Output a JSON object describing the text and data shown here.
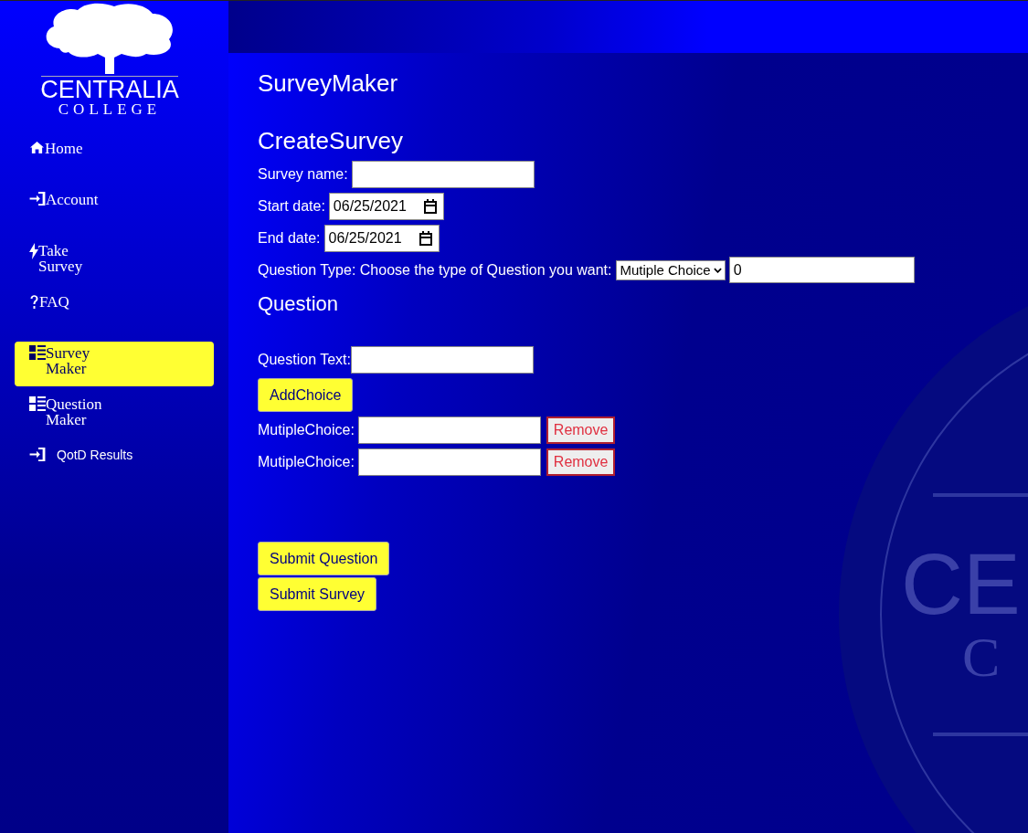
{
  "logo": {
    "name": "CENTRALIA",
    "subname": "COLLEGE"
  },
  "sidebar": {
    "items": [
      {
        "label": "Home",
        "selected": false
      },
      {
        "label": "Account",
        "selected": false
      },
      {
        "label": "Take Survey",
        "selected": false
      },
      {
        "label": "FAQ",
        "selected": false
      },
      {
        "label": "Survey Maker",
        "selected": true
      },
      {
        "label": "Question Maker",
        "selected": false
      },
      {
        "label": "QotD Results",
        "selected": false
      }
    ]
  },
  "page_title": "SurveyMaker",
  "section_title": "CreateSurvey",
  "form": {
    "survey_name_label": "Survey name:",
    "start_date_label": "Start date:",
    "start_date": "06/25/2021",
    "end_date_label": "End date:",
    "end_date": "06/25/2021",
    "question_type_label": "Question Type: Choose the type of Question you want:",
    "question_type": "Mutiple Choice",
    "count": "0"
  },
  "question": {
    "title": "Question",
    "text_label": "Question Text:",
    "add_choice": "AddChoice",
    "choices": [
      {
        "label": "MutipleChoice:",
        "remove": "Remove"
      },
      {
        "label": "MutipleChoice:",
        "remove": "Remove"
      }
    ]
  },
  "buttons": [
    "Submit Question",
    "Submit Survey"
  ],
  "seal": {
    "title": "CE",
    "subtitle": "C"
  }
}
